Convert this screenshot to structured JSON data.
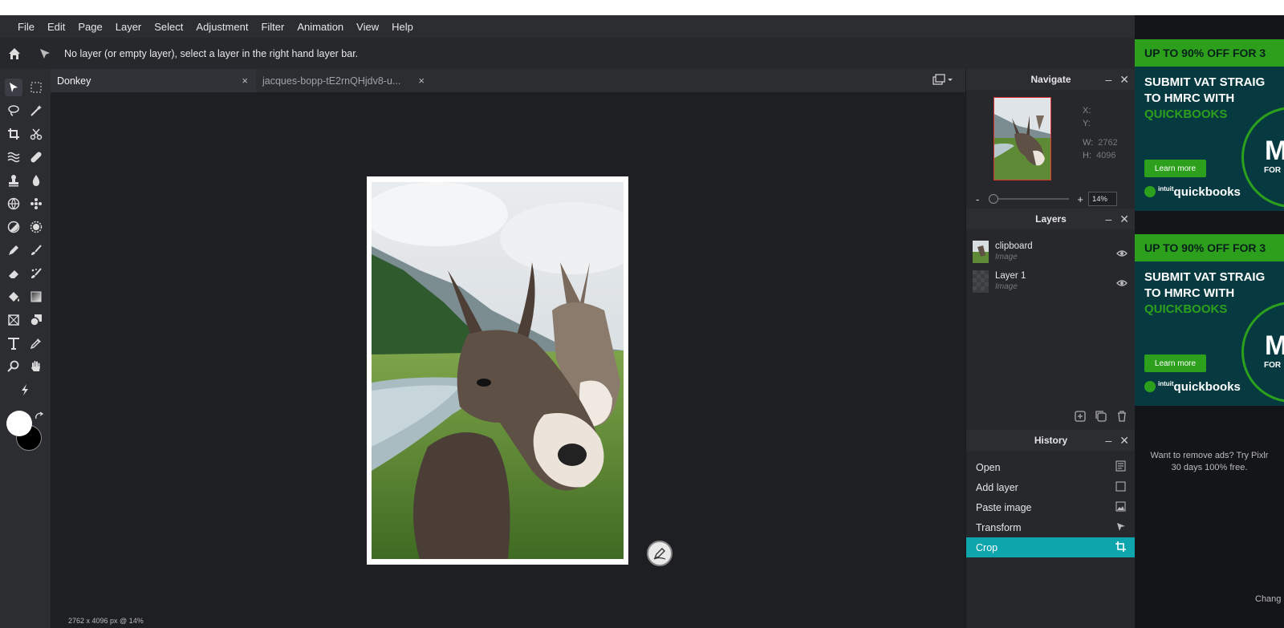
{
  "menu": [
    "File",
    "Edit",
    "Page",
    "Layer",
    "Select",
    "Adjustment",
    "Filter",
    "Animation",
    "View",
    "Help"
  ],
  "options_bar": {
    "hint": "No layer (or empty layer), select a layer in the right hand layer bar."
  },
  "tabs": [
    {
      "label": "Donkey",
      "close": "×"
    },
    {
      "label": "jacques-bopp-tE2rnQHjdv8-u...",
      "close": "×"
    }
  ],
  "status": {
    "text": "2762 x 4096 px @ 14%"
  },
  "navigate": {
    "title": "Navigate",
    "x_label": "X:",
    "y_label": "Y:",
    "w_label": "W:",
    "w_value": "2762",
    "h_label": "H:",
    "h_value": "4096",
    "zoom_minus": "-",
    "zoom_plus": "+",
    "zoom_value": "14%"
  },
  "layers": {
    "title": "Layers",
    "items": [
      {
        "name": "clipboard",
        "type": "Image"
      },
      {
        "name": "Layer 1",
        "type": "Image"
      }
    ]
  },
  "history": {
    "title": "History",
    "items": [
      {
        "label": "Open"
      },
      {
        "label": "Add layer"
      },
      {
        "label": "Paste image"
      },
      {
        "label": "Transform"
      },
      {
        "label": "Crop"
      }
    ]
  },
  "ads": {
    "banner": "UP TO 90% OFF FOR 3",
    "line1": "SUBMIT VAT STRAIG",
    "line2": "TO HMRC WITH",
    "line3": "QUICKBOOKS",
    "button": "Learn more",
    "brand_small": "intuit",
    "brand": "quickbooks",
    "big_letter": "M",
    "small_for": "FOR",
    "remove_line1": "Want to remove ads? Try Pixlr",
    "remove_line2": "30 days 100% free.",
    "change": "Chang"
  },
  "colors": {
    "accent": "#0ea5ad",
    "ad_green": "#2ca01c",
    "ad_bg": "#063a40"
  }
}
